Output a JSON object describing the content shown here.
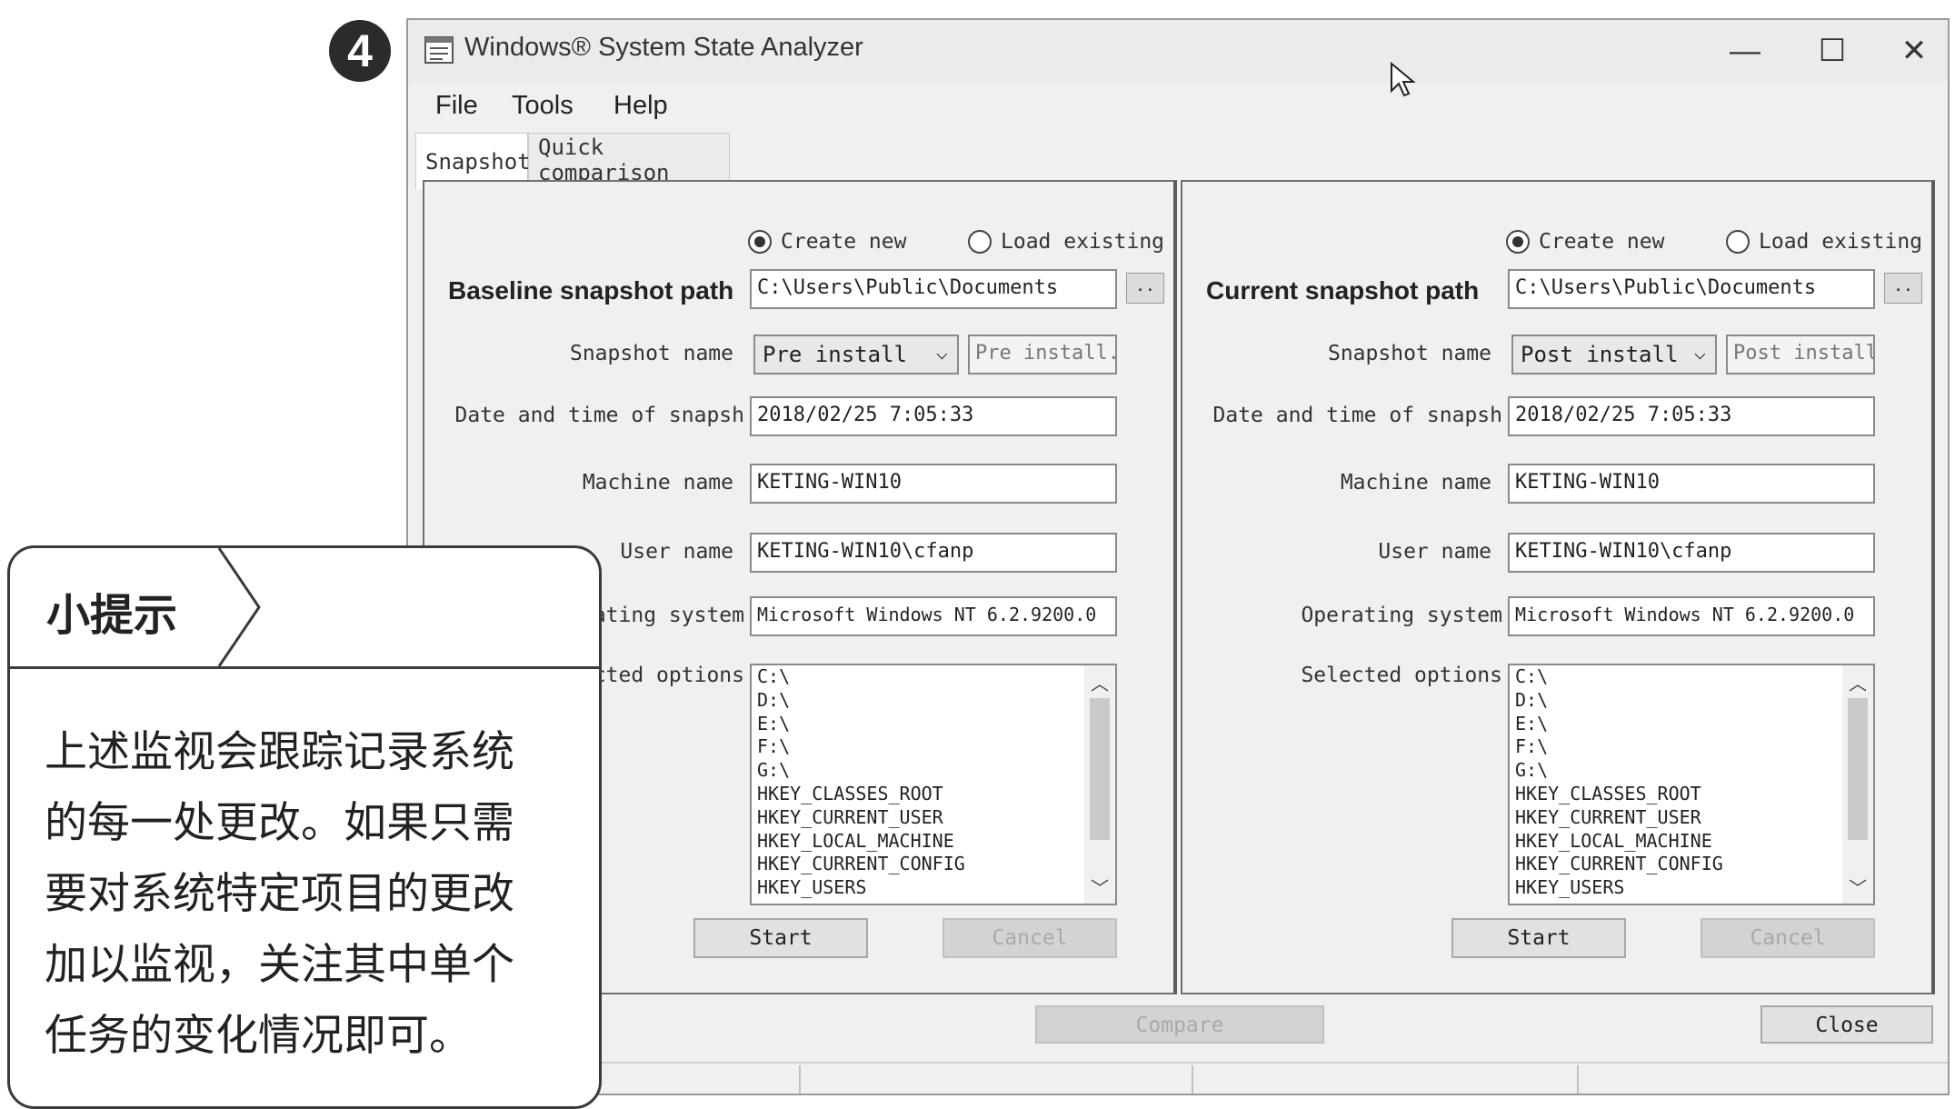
{
  "step_number": "4",
  "window": {
    "title": "Windows® System State Analyzer",
    "controls": {
      "minimize": "—",
      "maximize": "☐",
      "close": "✕"
    }
  },
  "menu": [
    "File",
    "Tools",
    "Help"
  ],
  "tabs": [
    {
      "label": "Snapshot",
      "active": true
    },
    {
      "label": "Quick comparison",
      "active": false
    }
  ],
  "panels": [
    {
      "radio_create": "Create new",
      "radio_load": "Load existing",
      "selected_radio": "create",
      "path_label": "Baseline snapshot path",
      "path_value": "C:\\Users\\Public\\Documents",
      "browse_label": "..",
      "snapshot_name_label": "Snapshot name",
      "snapshot_name_value": "Pre install",
      "snapshot_name_text": "Pre install.",
      "datetime_label": "Date and time of snapsh",
      "datetime_value": "2018/02/25 7:05:33",
      "machine_label": "Machine name",
      "machine_value": "KETING-WIN10",
      "user_label": "User name",
      "user_value": "KETING-WIN10\\cfanp",
      "os_label": "Operating system",
      "os_value": "Microsoft Windows NT 6.2.9200.0",
      "options_label": "Selected options",
      "options": [
        "C:\\",
        "D:\\",
        "E:\\",
        "F:\\",
        "G:\\",
        "HKEY_CLASSES_ROOT",
        "HKEY_CURRENT_USER",
        "HKEY_LOCAL_MACHINE",
        "HKEY_CURRENT_CONFIG",
        "HKEY_USERS"
      ],
      "start_label": "Start",
      "cancel_label": "Cancel"
    },
    {
      "radio_create": "Create new",
      "radio_load": "Load existing",
      "selected_radio": "create",
      "path_label": "Current snapshot path",
      "path_value": "C:\\Users\\Public\\Documents",
      "browse_label": "..",
      "snapshot_name_label": "Snapshot name",
      "snapshot_name_value": "Post install",
      "snapshot_name_text": "Post install",
      "datetime_label": "Date and time of snapsh",
      "datetime_value": "2018/02/25 7:05:33",
      "machine_label": "Machine name",
      "machine_value": "KETING-WIN10",
      "user_label": "User name",
      "user_value": "KETING-WIN10\\cfanp",
      "os_label": "Operating system",
      "os_value": "Microsoft Windows NT 6.2.9200.0",
      "options_label": "Selected options",
      "options": [
        "C:\\",
        "D:\\",
        "E:\\",
        "F:\\",
        "G:\\",
        "HKEY_CLASSES_ROOT",
        "HKEY_CURRENT_USER",
        "HKEY_LOCAL_MACHINE",
        "HKEY_CURRENT_CONFIG",
        "HKEY_USERS"
      ],
      "start_label": "Start",
      "cancel_label": "Cancel"
    }
  ],
  "compare_label": "Compare",
  "close_label": "Close",
  "tip": {
    "title": "小提示",
    "lines": [
      "上述监视会跟踪记录系统",
      "的每一处更改。如果只需",
      "要对系统特定项目的更改",
      "加以监视，关注其中单个",
      "任务的变化情况即可。"
    ]
  }
}
